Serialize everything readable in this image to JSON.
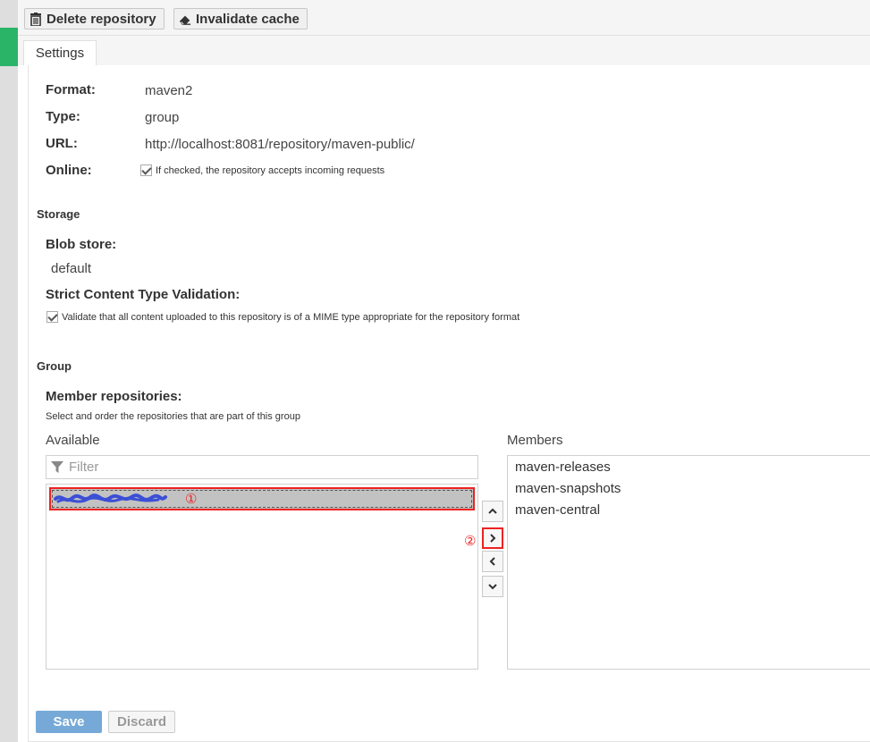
{
  "toolbar": {
    "delete_label": "Delete repository",
    "invalidate_label": "Invalidate cache"
  },
  "tabs": [
    {
      "label": "Settings"
    }
  ],
  "settings": {
    "format_label": "Format:",
    "format_value": "maven2",
    "type_label": "Type:",
    "type_value": "group",
    "url_label": "URL:",
    "url_value": "http://localhost:8081/repository/maven-public/",
    "online_label": "Online:",
    "online_checked": true,
    "online_help": "If checked, the repository accepts incoming requests"
  },
  "storage": {
    "section_title": "Storage",
    "blob_label": "Blob store:",
    "blob_value": "default",
    "strict_label": "Strict Content Type Validation:",
    "strict_checked": true,
    "strict_help": "Validate that all content uploaded to this repository is of a MIME type appropriate for the repository format"
  },
  "group": {
    "section_title": "Group",
    "member_label": "Member repositories:",
    "member_help": "Select and order the repositories that are part of this group",
    "available_label": "Available",
    "members_label": "Members",
    "filter_placeholder": "Filter",
    "members": [
      "maven-releases",
      "maven-snapshots",
      "maven-central"
    ]
  },
  "annotations": {
    "one": "①",
    "two": "②"
  },
  "footer": {
    "save_label": "Save",
    "discard_label": "Discard"
  },
  "colors": {
    "accent_green": "#2ab468",
    "save_blue": "#76a9d8",
    "annotation_red": "#ee2222",
    "scribble_blue": "#3b4fd6"
  }
}
